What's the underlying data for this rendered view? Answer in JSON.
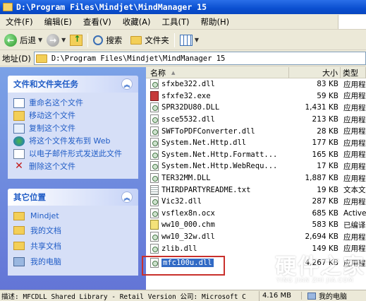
{
  "window": {
    "title": "D:\\Program Files\\Mindjet\\MindManager 15"
  },
  "menu": [
    "文件(F)",
    "编辑(E)",
    "查看(V)",
    "收藏(A)",
    "工具(T)",
    "帮助(H)"
  ],
  "toolbar": {
    "back": "后退",
    "search": "搜索",
    "folders": "文件夹"
  },
  "address": {
    "label": "地址(D)",
    "path": "D:\\Program Files\\Mindjet\\MindManager 15"
  },
  "tasks": {
    "title": "文件和文件夹任务",
    "items": [
      "重命名这个文件",
      "移动这个文件",
      "复制这个文件",
      "将这个文件发布到 Web",
      "以电子邮件形式发送此文件",
      "删除这个文件"
    ]
  },
  "places": {
    "title": "其它位置",
    "items": [
      "Mindjet",
      "我的文档",
      "共享文档",
      "我的电脑"
    ]
  },
  "columns": {
    "name": "名称",
    "size": "大小",
    "type": "类型"
  },
  "files": [
    {
      "name": "sfxbe322.dll",
      "size": "83 KB",
      "type": "应用程序扩展"
    },
    {
      "name": "sfxfe32.exe",
      "size": "59 KB",
      "type": "应用程序"
    },
    {
      "name": "SPR32DU80.DLL",
      "size": "1,431 KB",
      "type": "应用程序扩展"
    },
    {
      "name": "ssce5532.dll",
      "size": "213 KB",
      "type": "应用程序扩展"
    },
    {
      "name": "SWFToPDFConverter.dll",
      "size": "28 KB",
      "type": "应用程序扩展"
    },
    {
      "name": "System.Net.Http.dll",
      "size": "177 KB",
      "type": "应用程序扩展"
    },
    {
      "name": "System.Net.Http.Formatt...",
      "size": "165 KB",
      "type": "应用程序扩展"
    },
    {
      "name": "System.Net.Http.WebRequ...",
      "size": "17 KB",
      "type": "应用程序扩展"
    },
    {
      "name": "TER32MM.DLL",
      "size": "1,887 KB",
      "type": "应用程序扩展"
    },
    {
      "name": "THIRDPARTYREADME.txt",
      "size": "19 KB",
      "type": "文本文档"
    },
    {
      "name": "Vic32.dll",
      "size": "287 KB",
      "type": "应用程序扩展"
    },
    {
      "name": "vsflex8n.ocx",
      "size": "685 KB",
      "type": "ActiveX 控件"
    },
    {
      "name": "ww10_000.chm",
      "size": "583 KB",
      "type": "已编译的 HTML 帮助文件"
    },
    {
      "name": "ww10_32w.dll",
      "size": "2,694 KB",
      "type": "应用程序扩展"
    },
    {
      "name": "zlib.dll",
      "size": "149 KB",
      "type": "应用程序扩展"
    },
    {
      "name": "mfc100u.dll",
      "size": "4,267 KB",
      "type": "应用程序扩展"
    }
  ],
  "status": {
    "description": "描述: MFCDLL Shared Library - Retail Version 公司: Microsoft C",
    "size": "4.16 MB",
    "location": "我的电脑"
  },
  "watermark": {
    "text": "硬件之家",
    "sub": "YING JIAN ZHI JIA.COM"
  },
  "colors": {
    "titlebar": "#0a4fd0",
    "taskpane": "#6375d6",
    "selection": "#316ac5",
    "highlight_box": "#c9302c",
    "link": "#215dc6"
  }
}
